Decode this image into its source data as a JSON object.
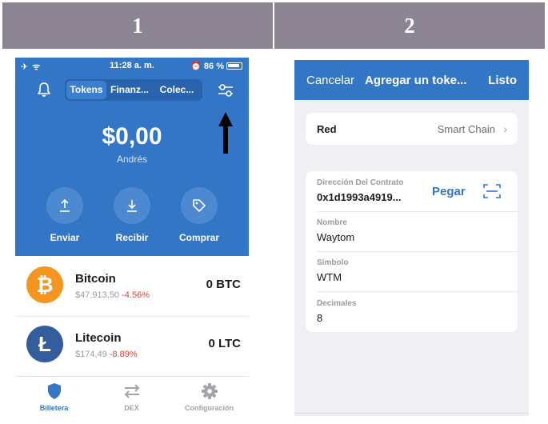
{
  "steps": {
    "one": "1",
    "two": "2"
  },
  "phone1": {
    "status": {
      "signal": "✈ ᯤ",
      "time": "11:28 a. m.",
      "battery": "⏰ 86 %"
    },
    "segments": [
      "Tokens",
      "Finanz...",
      "Colec..."
    ],
    "balance": "$0,00",
    "wallet_name": "Andrés",
    "actions": [
      "Enviar",
      "Recibir",
      "Comprar"
    ],
    "coins": [
      {
        "name": "Bitcoin",
        "price": "$47.913,50",
        "change": "-4.56%",
        "balance": "0 BTC",
        "symbol": "₿",
        "color": "#f3951f"
      },
      {
        "name": "Litecoin",
        "price": "$174,49",
        "change": "-8.89%",
        "balance": "0 LTC",
        "symbol": "Ł",
        "color": "#345d9d"
      }
    ],
    "tabs": [
      "Billetera",
      "DEX",
      "Configuración"
    ],
    "colors": {
      "accent": "#3476c6",
      "negative": "#d4453c"
    }
  },
  "phone2": {
    "nav": {
      "cancel": "Cancelar",
      "title": "Agregar un toke...",
      "done": "Listo"
    },
    "network": {
      "label": "Red",
      "value": "Smart Chain"
    },
    "contract": {
      "label": "Dirección Del Contrato",
      "value": "0x1d1993a4919...",
      "paste": "Pegar"
    },
    "name": {
      "label": "Nombre",
      "value": "Waytom"
    },
    "symbol": {
      "label": "Símbolo",
      "value": "WTM"
    },
    "decimals": {
      "label": "Decimales",
      "value": "8"
    }
  }
}
